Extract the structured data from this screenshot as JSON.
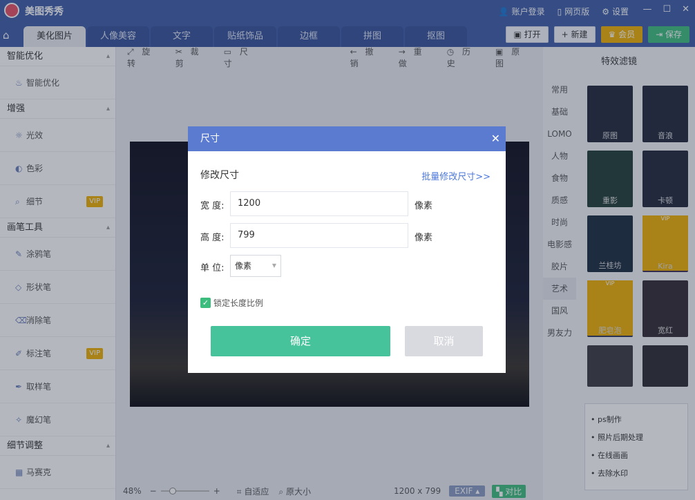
{
  "app": {
    "name": "美图秀秀"
  },
  "titlebar": {
    "login": "账户登录",
    "web": "网页版",
    "settings": "设置"
  },
  "tabs": [
    "美化图片",
    "人像美容",
    "文字",
    "贴纸饰品",
    "边框",
    "拼图",
    "抠图"
  ],
  "header_buttons": {
    "open": "打开",
    "new": "新建",
    "vip": "会员",
    "save": "保存"
  },
  "sidebar": {
    "sections": [
      {
        "title": "智能优化",
        "items": [
          {
            "label": "智能优化",
            "icon": "smart-icon"
          }
        ]
      },
      {
        "title": "增强",
        "items": [
          {
            "label": "光效",
            "icon": "light-icon"
          },
          {
            "label": "色彩",
            "icon": "palette-icon"
          },
          {
            "label": "细节",
            "icon": "detail-icon",
            "vip": "VIP"
          }
        ]
      },
      {
        "title": "画笔工具",
        "items": [
          {
            "label": "涂鸦笔",
            "icon": "doodle-icon"
          },
          {
            "label": "形状笔",
            "icon": "shape-icon"
          },
          {
            "label": "消除笔",
            "icon": "eraser-icon"
          },
          {
            "label": "标注笔",
            "icon": "marker-icon",
            "vip": "VIP"
          },
          {
            "label": "取样笔",
            "icon": "sample-icon"
          },
          {
            "label": "魔幻笔",
            "icon": "magic-icon"
          }
        ]
      },
      {
        "title": "细节调整",
        "items": [
          {
            "label": "马赛克",
            "icon": "mosaic-icon"
          }
        ]
      }
    ]
  },
  "toolbar": {
    "rotate": "旋转",
    "crop": "裁剪",
    "size": "尺寸",
    "undo": "撤销",
    "redo": "重做",
    "history": "历史",
    "original": "原图"
  },
  "statusbar": {
    "zoom": "48%",
    "fit": "自适应",
    "actual": "原大小",
    "dims": "1200 x 799",
    "exif": "EXIF",
    "compare": "对比"
  },
  "filters": {
    "title": "特效滤镜",
    "categories": [
      "常用",
      "基础",
      "LOMO",
      "人物",
      "食物",
      "质感",
      "时尚",
      "电影感",
      "胶片",
      "艺术",
      "国风",
      "男友力"
    ],
    "active_category": "艺术",
    "thumbs": [
      {
        "label": "原图"
      },
      {
        "label": "音浪"
      },
      {
        "label": "重影"
      },
      {
        "label": "卡顿"
      },
      {
        "label": "兰桂坊"
      },
      {
        "label": "Kira",
        "vip": "VIP"
      },
      {
        "label": "肥皂泡",
        "vip": "VIP"
      },
      {
        "label": "宽红"
      },
      {
        "label": ""
      },
      {
        "label": ""
      }
    ],
    "links": [
      "ps制作",
      "照片后期处理",
      "在线画画",
      "去除水印"
    ]
  },
  "dialog": {
    "title": "尺寸",
    "subtitle": "修改尺寸",
    "batch_link": "批量修改尺寸>>",
    "width_label": "宽 度:",
    "width_value": "1200",
    "height_label": "高 度:",
    "height_value": "799",
    "unit_px": "像素",
    "unit_label": "单 位:",
    "unit_value": "像素",
    "lock_ratio": "锁定长度比例",
    "ok": "确定",
    "cancel": "取消"
  }
}
